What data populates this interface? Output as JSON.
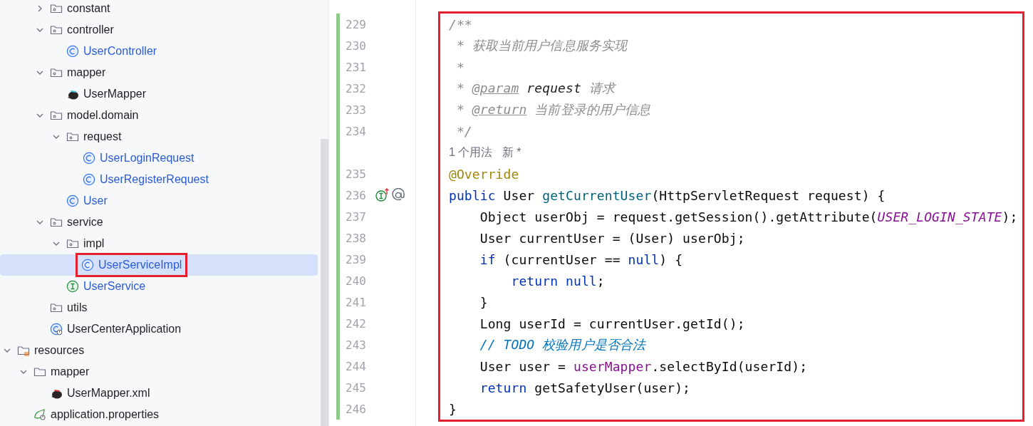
{
  "project_tree": [
    {
      "kind": "offscreen_parent",
      "children": [
        {
          "kind": "offscreen_parent",
          "children": [
            {
              "label": "constant",
              "kind": "package",
              "expanded": false,
              "selected": false
            },
            {
              "label": "controller",
              "kind": "package",
              "expanded": true,
              "selected": false,
              "children": [
                {
                  "label": "UserController",
                  "kind": "class",
                  "selected": false
                }
              ]
            },
            {
              "label": "mapper",
              "kind": "package",
              "expanded": true,
              "selected": false,
              "children": [
                {
                  "label": "UserMapper",
                  "kind": "mapper",
                  "selected": false
                }
              ]
            },
            {
              "label": "model.domain",
              "kind": "package",
              "expanded": true,
              "selected": false,
              "children": [
                {
                  "label": "request",
                  "kind": "package",
                  "expanded": true,
                  "selected": false,
                  "children": [
                    {
                      "label": "UserLoginRequest",
                      "kind": "class",
                      "selected": false
                    },
                    {
                      "label": "UserRegisterRequest",
                      "kind": "class",
                      "selected": false
                    }
                  ]
                },
                {
                  "label": "User",
                  "kind": "class",
                  "selected": false
                }
              ]
            },
            {
              "label": "service",
              "kind": "package",
              "expanded": true,
              "selected": false,
              "children": [
                {
                  "label": "impl",
                  "kind": "package",
                  "expanded": true,
                  "selected": false,
                  "children": [
                    {
                      "label": "UserServiceImpl",
                      "kind": "class",
                      "selected": true,
                      "marked": true
                    }
                  ]
                },
                {
                  "label": "UserService",
                  "kind": "interface",
                  "selected": false
                }
              ]
            },
            {
              "label": "utils",
              "kind": "package",
              "selected": false
            },
            {
              "label": "UserCenterApplication",
              "kind": "application",
              "selected": false
            }
          ]
        }
      ]
    },
    {
      "label": "resources",
      "kind": "resources",
      "expanded": true,
      "selected": false,
      "children": [
        {
          "label": "mapper",
          "kind": "folder",
          "expanded": true,
          "selected": false,
          "children": [
            {
              "label": "UserMapper.xml",
              "kind": "mapper_xml",
              "selected": false
            }
          ]
        },
        {
          "label": "application.properties",
          "kind": "properties",
          "selected": false
        }
      ]
    }
  ],
  "editor": {
    "annotation_box": true,
    "lines": [
      {
        "number": "229",
        "changed": true,
        "tokens": [
          {
            "text": "/**",
            "kind": "comment"
          }
        ]
      },
      {
        "number": "230",
        "changed": true,
        "tokens": [
          {
            "text": " * 获取当前用户信息服务实现",
            "kind": "comment"
          }
        ]
      },
      {
        "number": "231",
        "changed": true,
        "tokens": [
          {
            "text": " *",
            "kind": "comment"
          }
        ]
      },
      {
        "number": "232",
        "changed": true,
        "tokens": [
          {
            "text": " * ",
            "kind": "comment"
          },
          {
            "text": "@param",
            "kind": "doc_tag"
          },
          {
            "text": " request",
            "kind": "doc_param"
          },
          {
            "text": " 请求",
            "kind": "comment"
          }
        ]
      },
      {
        "number": "233",
        "changed": true,
        "tokens": [
          {
            "text": " * ",
            "kind": "comment"
          },
          {
            "text": "@return",
            "kind": "doc_tag"
          },
          {
            "text": " 当前登录的用户信息",
            "kind": "comment"
          }
        ]
      },
      {
        "number": "234",
        "changed": true,
        "tokens": [
          {
            "text": " */",
            "kind": "comment"
          }
        ]
      },
      {
        "kind": "inlay",
        "changed": true,
        "text": "1 个用法   新 *"
      },
      {
        "number": "235",
        "changed": true,
        "tokens": [
          {
            "text": "@Override",
            "kind": "annotation"
          }
        ]
      },
      {
        "number": "236",
        "changed": true,
        "markers": [
          {
            "kind": "implements"
          },
          {
            "kind": "annotation"
          }
        ],
        "tokens": [
          {
            "text": "public",
            "kind": "keyword"
          },
          {
            "text": " User ",
            "kind": "plain"
          },
          {
            "text": "getCurrentUser",
            "kind": "method"
          },
          {
            "text": "(HttpServletRequest request) {",
            "kind": "plain"
          }
        ]
      },
      {
        "number": "237",
        "changed": true,
        "tokens": [
          {
            "text": "    Object userObj = request.getSession().getAttribute(",
            "kind": "plain"
          },
          {
            "text": "USER_LOGIN_STATE",
            "kind": "constant"
          },
          {
            "text": ");",
            "kind": "plain"
          }
        ]
      },
      {
        "number": "238",
        "changed": true,
        "tokens": [
          {
            "text": "    User currentUser = (User) userObj;",
            "kind": "plain"
          }
        ]
      },
      {
        "number": "239",
        "changed": true,
        "tokens": [
          {
            "text": "    if",
            "kind": "keyword"
          },
          {
            "text": " (currentUser == ",
            "kind": "plain"
          },
          {
            "text": "null",
            "kind": "keyword"
          },
          {
            "text": ") {",
            "kind": "plain"
          }
        ]
      },
      {
        "number": "240",
        "changed": true,
        "tokens": [
          {
            "text": "        return",
            "kind": "keyword"
          },
          {
            "text": " null",
            "kind": "keyword"
          },
          {
            "text": ";",
            "kind": "plain"
          }
        ]
      },
      {
        "number": "241",
        "changed": true,
        "tokens": [
          {
            "text": "    }",
            "kind": "plain"
          }
        ]
      },
      {
        "number": "242",
        "changed": true,
        "tokens": [
          {
            "text": "    Long userId = currentUser.getId();",
            "kind": "plain"
          }
        ]
      },
      {
        "number": "243",
        "changed": true,
        "tokens": [
          {
            "text": "    // TODO 校验用户是否合法",
            "kind": "todo"
          }
        ]
      },
      {
        "number": "244",
        "changed": true,
        "tokens": [
          {
            "text": "    User user = ",
            "kind": "plain"
          },
          {
            "text": "userMapper",
            "kind": "field"
          },
          {
            "text": ".selectById(userId);",
            "kind": "plain"
          }
        ]
      },
      {
        "number": "245",
        "changed": true,
        "tokens": [
          {
            "text": "    return",
            "kind": "keyword"
          },
          {
            "text": " getSafetyUser(user);",
            "kind": "plain"
          }
        ]
      },
      {
        "number": "246",
        "changed": true,
        "tokens": [
          {
            "text": "}",
            "kind": "plain"
          }
        ]
      }
    ]
  }
}
